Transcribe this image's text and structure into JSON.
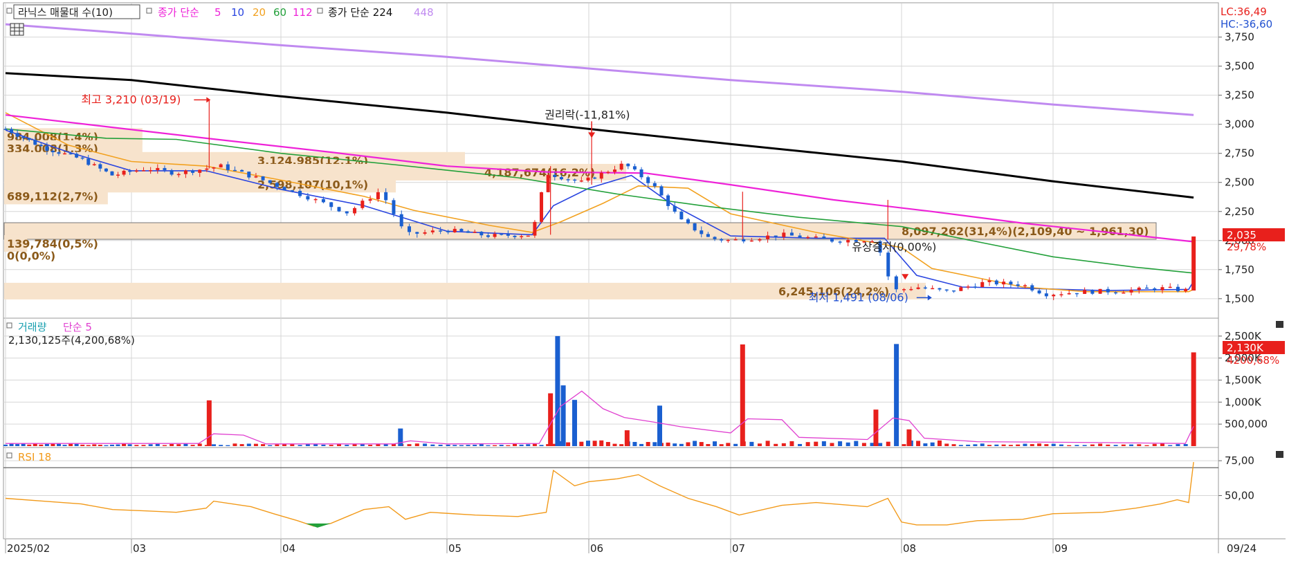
{
  "colors": {
    "up": "#e8201c",
    "down": "#1a5fd0",
    "ma5": "#2a45e0",
    "ma20": "#f2a11f",
    "ma60": "#22a03a",
    "ma112": "#ee22d8",
    "ma224": "#000000",
    "ma448": "#c08af0",
    "volma": "#e040d0",
    "rsi": "#f29a1a",
    "profile": "#f7e3cc",
    "grid": "#d6d6d6",
    "lc": "#e8201c",
    "hc": "#2050d0",
    "tag": "#e8201c"
  },
  "chart_data": [
    {
      "type": "candlestick",
      "title": "라닉스 매물대 수(10)",
      "legend": {
        "price_ma_label": "종가 단순",
        "price_ma_periods": [
          "5",
          "10",
          "20",
          "60",
          "112"
        ],
        "long_ma_label": "종가 단순 224",
        "long_ma_extra": "448"
      },
      "ylim": [
        1380,
        3950
      ],
      "y_ticks": [
        1500,
        1750,
        2000,
        2250,
        2500,
        2750,
        3000,
        3250,
        3500,
        3750
      ],
      "y_tick_labels": [
        "1,500",
        "1,750",
        "2,000",
        "2,250",
        "2,500",
        "2,750",
        "3,000",
        "3,250",
        "3,500",
        "3,750"
      ],
      "lc_label": "LC:36,49",
      "hc_label": "HC:-36,60",
      "last_price": 2035,
      "last_price_label": "2,035",
      "last_change_label": "29,78%",
      "x_months": [
        "2025/02",
        "03",
        "04",
        "05",
        "06",
        "07",
        "08",
        "09"
      ],
      "x_end_label": "09/24",
      "close_key_points": [
        {
          "month": 2.0,
          "close": 2960
        },
        {
          "month": 2.3,
          "close": 2800
        },
        {
          "month": 2.6,
          "close": 2700
        },
        {
          "month": 2.85,
          "close": 2560
        },
        {
          "month": 3.1,
          "close": 2620
        },
        {
          "month": 3.3,
          "close": 2580
        },
        {
          "month": 3.6,
          "close": 2640
        },
        {
          "month": 3.9,
          "close": 2510
        },
        {
          "month": 4.15,
          "close": 2380
        },
        {
          "month": 4.4,
          "close": 2240
        },
        {
          "month": 4.6,
          "close": 2430
        },
        {
          "month": 4.75,
          "close": 2050
        },
        {
          "month": 5.0,
          "close": 2090
        },
        {
          "month": 5.3,
          "close": 2040
        },
        {
          "month": 5.6,
          "close": 2050
        },
        {
          "month": 5.7,
          "close": 2580
        },
        {
          "month": 5.95,
          "close": 2500
        },
        {
          "month": 6.1,
          "close": 2580
        },
        {
          "month": 6.25,
          "close": 2660
        },
        {
          "month": 6.45,
          "close": 2480
        },
        {
          "month": 6.65,
          "close": 2170
        },
        {
          "month": 6.85,
          "close": 2020
        },
        {
          "month": 7.0,
          "close": 2000
        },
        {
          "month": 7.3,
          "close": 2050
        },
        {
          "month": 7.6,
          "close": 2000
        },
        {
          "month": 7.85,
          "close": 2010
        },
        {
          "month": 7.95,
          "close": 1570
        },
        {
          "month": 8.1,
          "close": 1600
        },
        {
          "month": 8.3,
          "close": 1560
        },
        {
          "month": 8.55,
          "close": 1640
        },
        {
          "month": 8.8,
          "close": 1620
        },
        {
          "month": 8.95,
          "close": 1540
        },
        {
          "month": 9.2,
          "close": 1560
        },
        {
          "month": 9.45,
          "close": 1570
        },
        {
          "month": 9.65,
          "close": 1590
        },
        {
          "month": 9.82,
          "close": 1570
        },
        {
          "month": 9.85,
          "close": 2035
        }
      ],
      "moving_averages": [
        {
          "name": "5",
          "color_key": "ma5",
          "points": [
            [
              2.0,
              2950
            ],
            [
              2.5,
              2760
            ],
            [
              3.0,
              2600
            ],
            [
              3.5,
              2600
            ],
            [
              4.0,
              2440
            ],
            [
              4.5,
              2300
            ],
            [
              5.0,
              2080
            ],
            [
              5.6,
              2050
            ],
            [
              5.75,
              2300
            ],
            [
              6.0,
              2450
            ],
            [
              6.3,
              2560
            ],
            [
              6.6,
              2300
            ],
            [
              7.0,
              2040
            ],
            [
              7.5,
              2020
            ],
            [
              7.9,
              2020
            ],
            [
              8.1,
              1700
            ],
            [
              8.4,
              1600
            ],
            [
              8.8,
              1590
            ],
            [
              9.3,
              1570
            ],
            [
              9.82,
              1580
            ],
            [
              9.85,
              1650
            ]
          ]
        },
        {
          "name": "10",
          "color_key": "ma20",
          "points": [
            [
              2.0,
              3100
            ],
            [
              2.5,
              2820
            ],
            [
              3.0,
              2680
            ],
            [
              3.5,
              2640
            ],
            [
              4.0,
              2520
            ],
            [
              4.5,
              2380
            ],
            [
              4.8,
              2260
            ],
            [
              5.3,
              2130
            ],
            [
              5.6,
              2070
            ],
            [
              5.8,
              2160
            ],
            [
              6.1,
              2320
            ],
            [
              6.35,
              2470
            ],
            [
              6.7,
              2450
            ],
            [
              7.0,
              2230
            ],
            [
              7.5,
              2070
            ],
            [
              8.0,
              1940
            ],
            [
              8.2,
              1760
            ],
            [
              8.5,
              1680
            ],
            [
              8.8,
              1600
            ],
            [
              9.2,
              1560
            ],
            [
              9.82,
              1560
            ],
            [
              9.85,
              1580
            ]
          ]
        },
        {
          "name": "60",
          "color_key": "ma60",
          "points": [
            [
              2.0,
              2960
            ],
            [
              2.8,
              2880
            ],
            [
              3.3,
              2870
            ],
            [
              4.0,
              2750
            ],
            [
              4.7,
              2650
            ],
            [
              5.5,
              2540
            ],
            [
              6.2,
              2400
            ],
            [
              6.8,
              2300
            ],
            [
              7.4,
              2200
            ],
            [
              8.0,
              2120
            ],
            [
              8.5,
              1990
            ],
            [
              9.0,
              1860
            ],
            [
              9.5,
              1770
            ],
            [
              9.85,
              1720
            ]
          ]
        },
        {
          "name": "112",
          "color_key": "ma112",
          "points": [
            [
              2.0,
              3080
            ],
            [
              2.8,
              2980
            ],
            [
              3.5,
              2880
            ],
            [
              4.3,
              2760
            ],
            [
              5.0,
              2640
            ],
            [
              5.7,
              2590
            ],
            [
              6.4,
              2580
            ],
            [
              7.0,
              2480
            ],
            [
              7.6,
              2350
            ],
            [
              8.2,
              2250
            ],
            [
              8.8,
              2150
            ],
            [
              9.4,
              2060
            ],
            [
              9.85,
              1990
            ]
          ]
        },
        {
          "name": "224",
          "color_key": "ma224",
          "points": [
            [
              2.0,
              3440
            ],
            [
              3.0,
              3380
            ],
            [
              4.0,
              3240
            ],
            [
              5.0,
              3100
            ],
            [
              6.0,
              2960
            ],
            [
              7.0,
              2830
            ],
            [
              8.0,
              2680
            ],
            [
              9.0,
              2510
            ],
            [
              9.85,
              2370
            ]
          ]
        },
        {
          "name": "448",
          "color_key": "ma448",
          "points": [
            [
              2.0,
              3860
            ],
            [
              3.0,
              3780
            ],
            [
              4.0,
              3680
            ],
            [
              5.0,
              3580
            ],
            [
              6.0,
              3480
            ],
            [
              7.0,
              3380
            ],
            [
              8.0,
              3280
            ],
            [
              9.0,
              3170
            ],
            [
              9.85,
              3080
            ]
          ]
        }
      ],
      "volume_profile": [
        {
          "price": 2895,
          "label": "984,008(1,4%)",
          "frac": 0.12
        },
        {
          "price": 2792,
          "label": "334,008(1,3%)",
          "frac": 0.12
        },
        {
          "price": 2690,
          "label": "3,124,985(12,1%)",
          "frac": 0.4
        },
        {
          "price": 2588,
          "label": "4,187,674(16,2%)",
          "frac": 0.54
        },
        {
          "price": 2485,
          "label": "2,598,107(10,1%)",
          "frac": 0.34
        },
        {
          "price": 2383,
          "label": "689,112(2,7%)",
          "frac": 0.09
        },
        {
          "price": 2082,
          "label": "8,097,262(31,4%)(2,109,40 ~ 1,961,30)",
          "frac": 1.0
        },
        {
          "price": 1975,
          "label": "139,784(0,5%)",
          "frac": 0.02
        },
        {
          "price": 1872,
          "label": "0(0,0%)",
          "frac": 0.0
        },
        {
          "price": 1565,
          "label": "6,245,106(24,2%)",
          "frac": 0.8
        }
      ],
      "annotations": [
        {
          "text": "최고 3,210 (03/19)",
          "month": 3.52,
          "price": 3210
        },
        {
          "text": "권리락(-11,81%)",
          "month": 6.02,
          "price": 2990
        },
        {
          "text": "유상증자(0,00%)",
          "month": 7.92,
          "price": 1890
        },
        {
          "text": "최저 1,491 (08/06)",
          "month": 8.2,
          "price": 1491
        }
      ]
    },
    {
      "type": "bar",
      "title": "거래량",
      "legend_ma": "단순 5",
      "subtitle": "2,130,125주(4,200,68%)",
      "ylim": [
        0,
        2750
      ],
      "y_ticks": [
        500,
        1000,
        1500,
        2000,
        2500
      ],
      "y_tick_labels": [
        "500,000",
        "1,000K",
        "1,500K",
        "2,000K",
        "2,500K"
      ],
      "last_label": "2,130K",
      "last_pct_label": "4200,68%",
      "spikes": [
        {
          "month": 3.52,
          "value": 1040,
          "up": true
        },
        {
          "month": 4.72,
          "value": 400,
          "up": false
        },
        {
          "month": 5.73,
          "value": 1200,
          "up": true
        },
        {
          "month": 5.78,
          "value": 2500,
          "up": false
        },
        {
          "month": 5.82,
          "value": 1380,
          "up": false
        },
        {
          "month": 5.9,
          "value": 1050,
          "up": false
        },
        {
          "month": 6.27,
          "value": 360,
          "up": true
        },
        {
          "month": 6.5,
          "value": 920,
          "up": false
        },
        {
          "month": 7.07,
          "value": 2310,
          "up": true
        },
        {
          "month": 7.85,
          "value": 830,
          "up": true
        },
        {
          "month": 7.97,
          "value": 2320,
          "up": false
        },
        {
          "month": 8.05,
          "value": 380,
          "up": true
        },
        {
          "month": 9.85,
          "value": 2130,
          "up": true
        }
      ],
      "volma_points": [
        [
          2.0,
          60
        ],
        [
          3.45,
          60
        ],
        [
          3.55,
          280
        ],
        [
          3.75,
          250
        ],
        [
          3.9,
          50
        ],
        [
          4.68,
          50
        ],
        [
          4.78,
          120
        ],
        [
          5.0,
          50
        ],
        [
          5.65,
          60
        ],
        [
          5.8,
          900
        ],
        [
          5.95,
          1250
        ],
        [
          6.1,
          850
        ],
        [
          6.25,
          650
        ],
        [
          6.45,
          550
        ],
        [
          6.65,
          440
        ],
        [
          7.0,
          300
        ],
        [
          7.1,
          620
        ],
        [
          7.3,
          600
        ],
        [
          7.4,
          200
        ],
        [
          7.8,
          150
        ],
        [
          7.95,
          640
        ],
        [
          8.05,
          580
        ],
        [
          8.15,
          180
        ],
        [
          8.5,
          100
        ],
        [
          9.3,
          80
        ],
        [
          9.8,
          60
        ],
        [
          9.85,
          450
        ]
      ]
    },
    {
      "type": "line",
      "title": "RSI 18",
      "ylim": [
        20,
        82
      ],
      "y_ticks": [
        50,
        75
      ],
      "y_tick_labels": [
        "50,00",
        "75,00"
      ],
      "reference_line": 70,
      "points": [
        [
          2.0,
          48
        ],
        [
          2.3,
          46
        ],
        [
          2.6,
          44
        ],
        [
          2.85,
          40
        ],
        [
          3.1,
          39
        ],
        [
          3.3,
          38
        ],
        [
          3.5,
          41
        ],
        [
          3.55,
          46
        ],
        [
          3.8,
          42
        ],
        [
          3.95,
          37
        ],
        [
          4.1,
          32
        ],
        [
          4.2,
          28
        ],
        [
          4.3,
          30
        ],
        [
          4.5,
          40
        ],
        [
          4.65,
          42
        ],
        [
          4.75,
          33
        ],
        [
          4.9,
          38
        ],
        [
          5.2,
          36
        ],
        [
          5.5,
          35
        ],
        [
          5.7,
          38
        ],
        [
          5.75,
          68
        ],
        [
          5.9,
          57
        ],
        [
          6.0,
          60
        ],
        [
          6.2,
          62
        ],
        [
          6.35,
          65
        ],
        [
          6.5,
          57
        ],
        [
          6.7,
          48
        ],
        [
          6.9,
          42
        ],
        [
          7.05,
          36
        ],
        [
          7.3,
          43
        ],
        [
          7.5,
          45
        ],
        [
          7.8,
          42
        ],
        [
          7.92,
          48
        ],
        [
          8.0,
          31
        ],
        [
          8.1,
          29
        ],
        [
          8.3,
          29
        ],
        [
          8.5,
          32
        ],
        [
          8.8,
          33
        ],
        [
          9.0,
          37
        ],
        [
          9.3,
          38
        ],
        [
          9.5,
          41
        ],
        [
          9.65,
          44
        ],
        [
          9.75,
          47
        ],
        [
          9.82,
          45
        ],
        [
          9.85,
          74
        ]
      ]
    }
  ]
}
